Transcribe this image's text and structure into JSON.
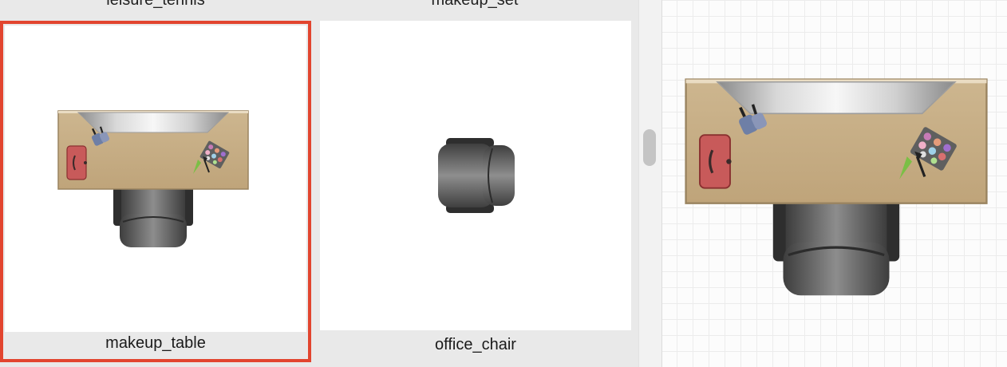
{
  "library": {
    "prev_row": [
      "leisure_tennis",
      "makeup_set"
    ],
    "items": [
      {
        "label": "makeup_table",
        "selected": true
      },
      {
        "label": "office_chair",
        "selected": false
      }
    ]
  },
  "colors": {
    "selection": "#e2452f",
    "desk_wood": "#c8b088",
    "chair": "#555555"
  },
  "icons": [
    "makeup-table-icon",
    "office-chair-icon"
  ]
}
